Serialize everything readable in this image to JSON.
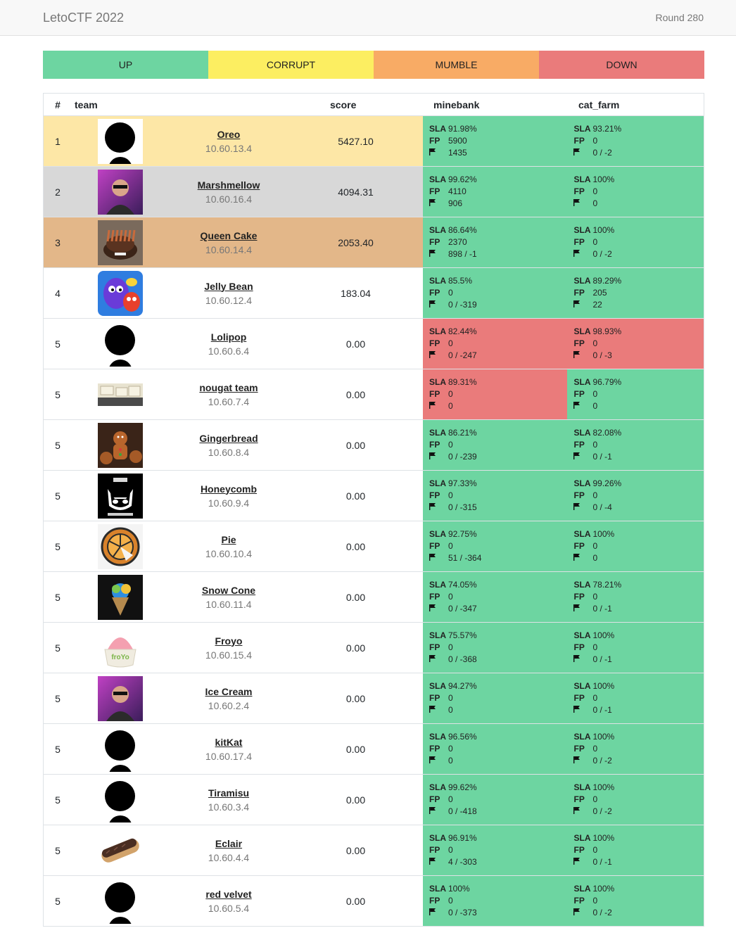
{
  "header": {
    "brand": "LetoCTF 2022",
    "round": "Round 280"
  },
  "legend": [
    {
      "label": "UP",
      "color": "#6dd5a1"
    },
    {
      "label": "CORRUPT",
      "color": "#fcee61"
    },
    {
      "label": "MUMBLE",
      "color": "#f8ab65"
    },
    {
      "label": "DOWN",
      "color": "#ea7b7b"
    }
  ],
  "columns": {
    "num": "#",
    "team": "team",
    "score": "score",
    "svc1": "minebank",
    "svc2": "cat_farm"
  },
  "colors": {
    "up": "#6dd5a1",
    "down": "#ea7b7b",
    "first": "#fde7a6",
    "second": "#d8d8d8",
    "third": "#e3b789"
  },
  "sla_label": "SLA",
  "fp_label": "FP",
  "teams": [
    {
      "rank": "1",
      "name": "Oreo",
      "ip": "10.60.13.4",
      "score": "5427.10",
      "logo": "placeholder-icon",
      "s1": {
        "sla": "91.98%",
        "fp": "5900",
        "flags": "1435",
        "state": "up"
      },
      "s2": {
        "sla": "93.21%",
        "fp": "0",
        "flags": "0 / -2",
        "state": "up"
      }
    },
    {
      "rank": "2",
      "name": "Marshmellow",
      "ip": "10.60.16.4",
      "score": "4094.31",
      "logo": "photo-logo",
      "s1": {
        "sla": "99.62%",
        "fp": "4110",
        "flags": "906",
        "state": "up"
      },
      "s2": {
        "sla": "100%",
        "fp": "0",
        "flags": "0",
        "state": "up"
      }
    },
    {
      "rank": "3",
      "name": "Queen Cake",
      "ip": "10.60.14.4",
      "score": "2053.40",
      "logo": "cake-logo",
      "s1": {
        "sla": "86.64%",
        "fp": "2370",
        "flags": "898 / -1",
        "state": "up"
      },
      "s2": {
        "sla": "100%",
        "fp": "0",
        "flags": "0 / -2",
        "state": "up"
      }
    },
    {
      "rank": "4",
      "name": "Jelly Bean",
      "ip": "10.60.12.4",
      "score": "183.04",
      "logo": "jelly-logo",
      "s1": {
        "sla": "85.5%",
        "fp": "0",
        "flags": "0 / -319",
        "state": "up"
      },
      "s2": {
        "sla": "89.29%",
        "fp": "205",
        "flags": "22",
        "state": "up"
      }
    },
    {
      "rank": "5",
      "name": "Lolipop",
      "ip": "10.60.6.4",
      "score": "0.00",
      "logo": "placeholder-icon",
      "s1": {
        "sla": "82.44%",
        "fp": "0",
        "flags": "0 / -247",
        "state": "down"
      },
      "s2": {
        "sla": "98.93%",
        "fp": "0",
        "flags": "0 / -3",
        "state": "down"
      }
    },
    {
      "rank": "5",
      "name": "nougat team",
      "ip": "10.60.7.4",
      "score": "0.00",
      "logo": "nougat-logo",
      "s1": {
        "sla": "89.31%",
        "fp": "0",
        "flags": "0",
        "state": "down"
      },
      "s2": {
        "sla": "96.79%",
        "fp": "0",
        "flags": "0",
        "state": "up"
      }
    },
    {
      "rank": "5",
      "name": "Gingerbread",
      "ip": "10.60.8.4",
      "score": "0.00",
      "logo": "gingerbread-logo",
      "s1": {
        "sla": "86.21%",
        "fp": "0",
        "flags": "0 / -239",
        "state": "up"
      },
      "s2": {
        "sla": "82.08%",
        "fp": "0",
        "flags": "0 / -1",
        "state": "up"
      }
    },
    {
      "rank": "5",
      "name": "Honeycomb",
      "ip": "10.60.9.4",
      "score": "0.00",
      "logo": "cat-logo",
      "s1": {
        "sla": "97.33%",
        "fp": "0",
        "flags": "0 / -315",
        "state": "up"
      },
      "s2": {
        "sla": "99.26%",
        "fp": "0",
        "flags": "0 / -4",
        "state": "up"
      }
    },
    {
      "rank": "5",
      "name": "Pie",
      "ip": "10.60.10.4",
      "score": "0.00",
      "logo": "pie-logo",
      "s1": {
        "sla": "92.75%",
        "fp": "0",
        "flags": "51 / -364",
        "state": "up"
      },
      "s2": {
        "sla": "100%",
        "fp": "0",
        "flags": "0",
        "state": "up"
      }
    },
    {
      "rank": "5",
      "name": "Snow Cone",
      "ip": "10.60.11.4",
      "score": "0.00",
      "logo": "snowcone-logo",
      "s1": {
        "sla": "74.05%",
        "fp": "0",
        "flags": "0 / -347",
        "state": "up"
      },
      "s2": {
        "sla": "78.21%",
        "fp": "0",
        "flags": "0 / -1",
        "state": "up"
      }
    },
    {
      "rank": "5",
      "name": "Froyo",
      "ip": "10.60.15.4",
      "score": "0.00",
      "logo": "froyo-logo",
      "s1": {
        "sla": "75.57%",
        "fp": "0",
        "flags": "0 / -368",
        "state": "up"
      },
      "s2": {
        "sla": "100%",
        "fp": "0",
        "flags": "0 / -1",
        "state": "up"
      }
    },
    {
      "rank": "5",
      "name": "Ice Cream",
      "ip": "10.60.2.4",
      "score": "0.00",
      "logo": "photo-logo",
      "s1": {
        "sla": "94.27%",
        "fp": "0",
        "flags": "0",
        "state": "up"
      },
      "s2": {
        "sla": "100%",
        "fp": "0",
        "flags": "0 / -1",
        "state": "up"
      }
    },
    {
      "rank": "5",
      "name": "kitKat",
      "ip": "10.60.17.4",
      "score": "0.00",
      "logo": "placeholder-icon",
      "s1": {
        "sla": "96.56%",
        "fp": "0",
        "flags": "0",
        "state": "up"
      },
      "s2": {
        "sla": "100%",
        "fp": "0",
        "flags": "0 / -2",
        "state": "up"
      }
    },
    {
      "rank": "5",
      "name": "Tiramisu",
      "ip": "10.60.3.4",
      "score": "0.00",
      "logo": "placeholder-icon",
      "s1": {
        "sla": "99.62%",
        "fp": "0",
        "flags": "0 / -418",
        "state": "up"
      },
      "s2": {
        "sla": "100%",
        "fp": "0",
        "flags": "0 / -2",
        "state": "up"
      }
    },
    {
      "rank": "5",
      "name": "Eclair",
      "ip": "10.60.4.4",
      "score": "0.00",
      "logo": "eclair-logo",
      "s1": {
        "sla": "96.91%",
        "fp": "0",
        "flags": "4 / -303",
        "state": "up"
      },
      "s2": {
        "sla": "100%",
        "fp": "0",
        "flags": "0 / -1",
        "state": "up"
      }
    },
    {
      "rank": "5",
      "name": "red velvet",
      "ip": "10.60.5.4",
      "score": "0.00",
      "logo": "placeholder-icon",
      "s1": {
        "sla": "100%",
        "fp": "0",
        "flags": "0 / -373",
        "state": "up"
      },
      "s2": {
        "sla": "100%",
        "fp": "0",
        "flags": "0 / -2",
        "state": "up"
      }
    }
  ]
}
